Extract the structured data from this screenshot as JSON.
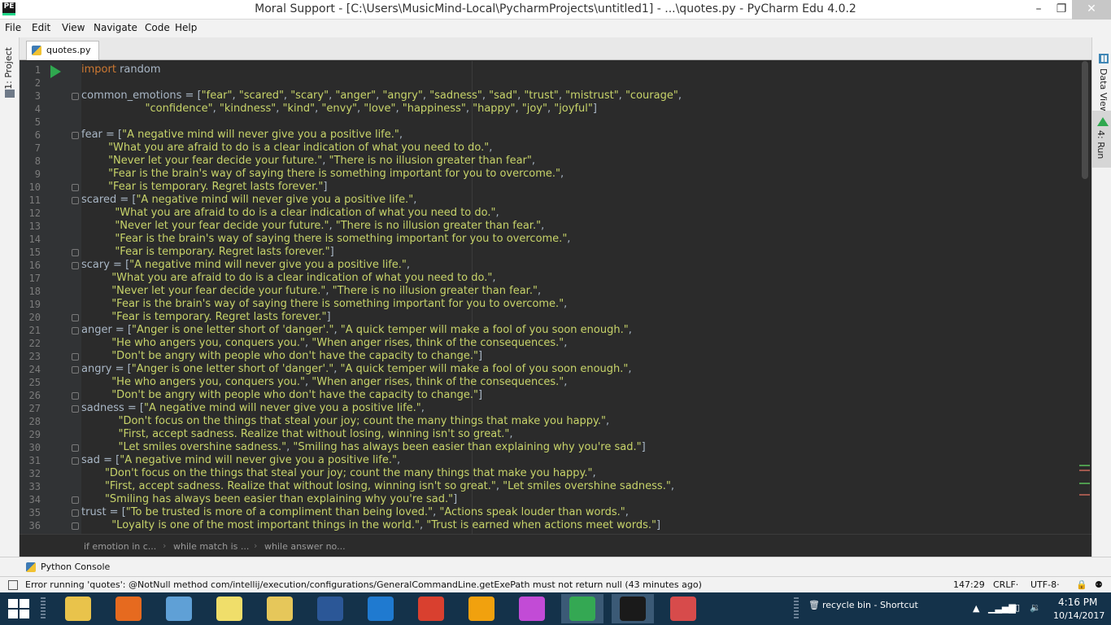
{
  "window": {
    "app_icon": "PE",
    "title": "Moral Support - [C:\\Users\\MusicMind-Local\\PycharmProjects\\untitled1] - ...\\quotes.py - PyCharm Edu 4.0.2",
    "min_glyph": "–",
    "max_glyph": "❐",
    "close_glyph": "✕"
  },
  "menu": [
    "File",
    "Edit",
    "View",
    "Navigate",
    "Code",
    "Help"
  ],
  "left_tools": {
    "project": "1: Project"
  },
  "right_tools": {
    "data_view": "Data View",
    "run": "4: Run"
  },
  "editor_tab": "quotes.py",
  "code": [
    {
      "n": "1",
      "t": [
        [
          "kw",
          "import "
        ],
        [
          "plain",
          "random"
        ]
      ]
    },
    {
      "n": "2",
      "t": []
    },
    {
      "n": "3",
      "t": [
        [
          "plain",
          "common_emotions = ["
        ],
        [
          "str",
          "\"fear\""
        ],
        [
          "plain",
          ", "
        ],
        [
          "str",
          "\"scared\""
        ],
        [
          "plain",
          ", "
        ],
        [
          "str",
          "\"scary\""
        ],
        [
          "plain",
          ", "
        ],
        [
          "str",
          "\"anger\""
        ],
        [
          "plain",
          ", "
        ],
        [
          "str",
          "\"angry\""
        ],
        [
          "plain",
          ", "
        ],
        [
          "str",
          "\"sadness\""
        ],
        [
          "plain",
          ", "
        ],
        [
          "str",
          "\"sad\""
        ],
        [
          "plain",
          ", "
        ],
        [
          "str",
          "\"trust\""
        ],
        [
          "plain",
          ", "
        ],
        [
          "str",
          "\"mistrust\""
        ],
        [
          "plain",
          ", "
        ],
        [
          "str",
          "\"courage\""
        ],
        [
          "plain",
          ","
        ]
      ]
    },
    {
      "n": "4",
      "t": [
        [
          "plain",
          "                   "
        ],
        [
          "str",
          "\"confidence\""
        ],
        [
          "plain",
          ", "
        ],
        [
          "str",
          "\"kindness\""
        ],
        [
          "plain",
          ", "
        ],
        [
          "str",
          "\"kind\""
        ],
        [
          "plain",
          ", "
        ],
        [
          "str",
          "\"envy\""
        ],
        [
          "plain",
          ", "
        ],
        [
          "str",
          "\"love\""
        ],
        [
          "plain",
          ", "
        ],
        [
          "str",
          "\"happiness\""
        ],
        [
          "plain",
          ", "
        ],
        [
          "str",
          "\"happy\""
        ],
        [
          "plain",
          ", "
        ],
        [
          "str",
          "\"joy\""
        ],
        [
          "plain",
          ", "
        ],
        [
          "str",
          "\"joyful\""
        ],
        [
          "plain",
          "]"
        ]
      ]
    },
    {
      "n": "5",
      "t": []
    },
    {
      "n": "6",
      "t": [
        [
          "plain",
          "fear = ["
        ],
        [
          "str",
          "\"A negative mind will never give you a positive life.\""
        ],
        [
          "plain",
          ","
        ]
      ]
    },
    {
      "n": "7",
      "t": [
        [
          "plain",
          "        "
        ],
        [
          "str",
          "\"What you are afraid to do is a clear indication of what you need to do.\""
        ],
        [
          "plain",
          ","
        ]
      ]
    },
    {
      "n": "8",
      "t": [
        [
          "plain",
          "        "
        ],
        [
          "str",
          "\"Never let your fear decide your future.\""
        ],
        [
          "plain",
          ", "
        ],
        [
          "str",
          "\"There is no illusion greater than fear\""
        ],
        [
          "plain",
          ","
        ]
      ]
    },
    {
      "n": "9",
      "t": [
        [
          "plain",
          "        "
        ],
        [
          "str",
          "\"Fear is the brain's way of saying there is something important for you to overcome.\""
        ],
        [
          "plain",
          ","
        ]
      ]
    },
    {
      "n": "10",
      "t": [
        [
          "plain",
          "        "
        ],
        [
          "str",
          "\"Fear is temporary. Regret lasts forever.\""
        ],
        [
          "plain",
          "]"
        ]
      ]
    },
    {
      "n": "11",
      "t": [
        [
          "plain",
          "scared = ["
        ],
        [
          "str",
          "\"A negative mind will never give you a positive life.\""
        ],
        [
          "plain",
          ","
        ]
      ]
    },
    {
      "n": "12",
      "t": [
        [
          "plain",
          "          "
        ],
        [
          "str",
          "\"What you are afraid to do is a clear indication of what you need to do.\""
        ],
        [
          "plain",
          ","
        ]
      ]
    },
    {
      "n": "13",
      "t": [
        [
          "plain",
          "          "
        ],
        [
          "str",
          "\"Never let your fear decide your future.\""
        ],
        [
          "plain",
          ", "
        ],
        [
          "str",
          "\"There is no illusion greater than fear.\""
        ],
        [
          "plain",
          ","
        ]
      ]
    },
    {
      "n": "14",
      "t": [
        [
          "plain",
          "          "
        ],
        [
          "str",
          "\"Fear is the brain's way of saying there is something important for you to overcome.\""
        ],
        [
          "plain",
          ","
        ]
      ]
    },
    {
      "n": "15",
      "t": [
        [
          "plain",
          "          "
        ],
        [
          "str",
          "\"Fear is temporary. Regret lasts forever.\""
        ],
        [
          "plain",
          "]"
        ]
      ]
    },
    {
      "n": "16",
      "t": [
        [
          "plain",
          "scary = ["
        ],
        [
          "str",
          "\"A negative mind will never give you a positive life.\""
        ],
        [
          "plain",
          ","
        ]
      ]
    },
    {
      "n": "17",
      "t": [
        [
          "plain",
          "         "
        ],
        [
          "str",
          "\"What you are afraid to do is a clear indication of what you need to do.\""
        ],
        [
          "plain",
          ","
        ]
      ]
    },
    {
      "n": "18",
      "t": [
        [
          "plain",
          "         "
        ],
        [
          "str",
          "\"Never let your fear decide your future.\""
        ],
        [
          "plain",
          ", "
        ],
        [
          "str",
          "\"There is no illusion greater than fear.\""
        ],
        [
          "plain",
          ","
        ]
      ]
    },
    {
      "n": "19",
      "t": [
        [
          "plain",
          "         "
        ],
        [
          "str",
          "\"Fear is the brain's way of saying there is something important for you to overcome.\""
        ],
        [
          "plain",
          ","
        ]
      ]
    },
    {
      "n": "20",
      "t": [
        [
          "plain",
          "         "
        ],
        [
          "str",
          "\"Fear is temporary. Regret lasts forever.\""
        ],
        [
          "plain",
          "]"
        ]
      ]
    },
    {
      "n": "21",
      "t": [
        [
          "plain",
          "anger = ["
        ],
        [
          "str",
          "\"Anger is one letter short of 'danger'.\""
        ],
        [
          "plain",
          ", "
        ],
        [
          "str",
          "\"A quick temper will make a fool of you soon enough.\""
        ],
        [
          "plain",
          ","
        ]
      ]
    },
    {
      "n": "22",
      "t": [
        [
          "plain",
          "         "
        ],
        [
          "str",
          "\"He who angers you, conquers you.\""
        ],
        [
          "plain",
          ", "
        ],
        [
          "str",
          "\"When anger rises, think of the consequences.\""
        ],
        [
          "plain",
          ","
        ]
      ]
    },
    {
      "n": "23",
      "t": [
        [
          "plain",
          "         "
        ],
        [
          "str",
          "\"Don't be angry with people who don't have the capacity to change.\""
        ],
        [
          "plain",
          "]"
        ]
      ]
    },
    {
      "n": "24",
      "t": [
        [
          "plain",
          "angry = ["
        ],
        [
          "str",
          "\"Anger is one letter short of 'danger'.\""
        ],
        [
          "plain",
          ", "
        ],
        [
          "str",
          "\"A quick temper will make a fool of you soon enough.\""
        ],
        [
          "plain",
          ","
        ]
      ]
    },
    {
      "n": "25",
      "t": [
        [
          "plain",
          "         "
        ],
        [
          "str",
          "\"He who angers you, conquers you.\""
        ],
        [
          "plain",
          ", "
        ],
        [
          "str",
          "\"When anger rises, think of the consequences.\""
        ],
        [
          "plain",
          ","
        ]
      ]
    },
    {
      "n": "26",
      "t": [
        [
          "plain",
          "         "
        ],
        [
          "str",
          "\"Don't be angry with people who don't have the capacity to change.\""
        ],
        [
          "plain",
          "]"
        ]
      ]
    },
    {
      "n": "27",
      "t": [
        [
          "plain",
          "sadness = ["
        ],
        [
          "str",
          "\"A negative mind will never give you a positive life.\""
        ],
        [
          "plain",
          ","
        ]
      ]
    },
    {
      "n": "28",
      "t": [
        [
          "plain",
          "           "
        ],
        [
          "str",
          "\"Don't focus on the things that steal your joy; count the many things that make you happy.\""
        ],
        [
          "plain",
          ","
        ]
      ]
    },
    {
      "n": "29",
      "t": [
        [
          "plain",
          "           "
        ],
        [
          "str",
          "\"First, accept sadness. Realize that without losing, winning isn't so great.\""
        ],
        [
          "plain",
          ","
        ]
      ]
    },
    {
      "n": "30",
      "t": [
        [
          "plain",
          "           "
        ],
        [
          "str",
          "\"Let smiles overshine sadness.\""
        ],
        [
          "plain",
          ", "
        ],
        [
          "str",
          "\"Smiling has always been easier than explaining why you're sad.\""
        ],
        [
          "plain",
          "]"
        ]
      ]
    },
    {
      "n": "31",
      "t": [
        [
          "plain",
          "sad = ["
        ],
        [
          "str",
          "\"A negative mind will never give you a positive life.\""
        ],
        [
          "plain",
          ","
        ]
      ]
    },
    {
      "n": "32",
      "t": [
        [
          "plain",
          "       "
        ],
        [
          "str",
          "\"Don't focus on the things that steal your joy; count the many things that make you happy.\""
        ],
        [
          "plain",
          ","
        ]
      ]
    },
    {
      "n": "33",
      "t": [
        [
          "plain",
          "       "
        ],
        [
          "str",
          "\"First, accept sadness. Realize that without losing, winning isn't so great.\""
        ],
        [
          "plain",
          ", "
        ],
        [
          "str",
          "\"Let smiles overshine sadness.\""
        ],
        [
          "plain",
          ","
        ]
      ]
    },
    {
      "n": "34",
      "t": [
        [
          "plain",
          "       "
        ],
        [
          "str",
          "\"Smiling has always been easier than explaining why you're sad.\""
        ],
        [
          "plain",
          "]"
        ]
      ]
    },
    {
      "n": "35",
      "t": [
        [
          "plain",
          "trust = ["
        ],
        [
          "str",
          "\"To be trusted is more of a compliment than being loved.\""
        ],
        [
          "plain",
          ", "
        ],
        [
          "str",
          "\"Actions speak louder than words.\""
        ],
        [
          "plain",
          ","
        ]
      ]
    },
    {
      "n": "36",
      "t": [
        [
          "plain",
          "         "
        ],
        [
          "str",
          "\"Loyalty is one of the most important things in the world.\""
        ],
        [
          "plain",
          ", "
        ],
        [
          "str",
          "\"Trust is earned when actions meet words.\""
        ],
        [
          "plain",
          "]"
        ]
      ]
    }
  ],
  "breadcrumbs": [
    "if emotion in c...",
    "while match is ...",
    "while answer no..."
  ],
  "console_tab": "Python Console",
  "status": {
    "message": "Error running 'quotes': @NotNull method com/intellij/execution/configurations/GeneralCommandLine.getExePath must not return null (43 minutes ago)",
    "position": "147:29",
    "line_sep": "CRLF‧",
    "encoding": "UTF-8‧"
  },
  "taskbar": {
    "apps": [
      {
        "name": "file-explorer",
        "color": "#e9c34b"
      },
      {
        "name": "firefox",
        "color": "#e66a1f"
      },
      {
        "name": "calculator",
        "color": "#5fa0d6"
      },
      {
        "name": "sticky-notes",
        "color": "#f0de6a"
      },
      {
        "name": "folder",
        "color": "#e6c75a"
      },
      {
        "name": "word",
        "color": "#2b5797"
      },
      {
        "name": "app-blue-circle",
        "color": "#1f7ad0"
      },
      {
        "name": "paint-brush",
        "color": "#d9402f"
      },
      {
        "name": "vlc-like",
        "color": "#f1a10e"
      },
      {
        "name": "itunes",
        "color": "#c24bd6"
      },
      {
        "name": "chrome",
        "color": "#34a853"
      },
      {
        "name": "pycharm-edu",
        "color": "#1a1a1a"
      },
      {
        "name": "snipping-tool",
        "color": "#d74b4b"
      }
    ],
    "pinned_shortcut": "recycle bin - Shortcut",
    "time": "4:16 PM",
    "date": "10/14/2017"
  }
}
